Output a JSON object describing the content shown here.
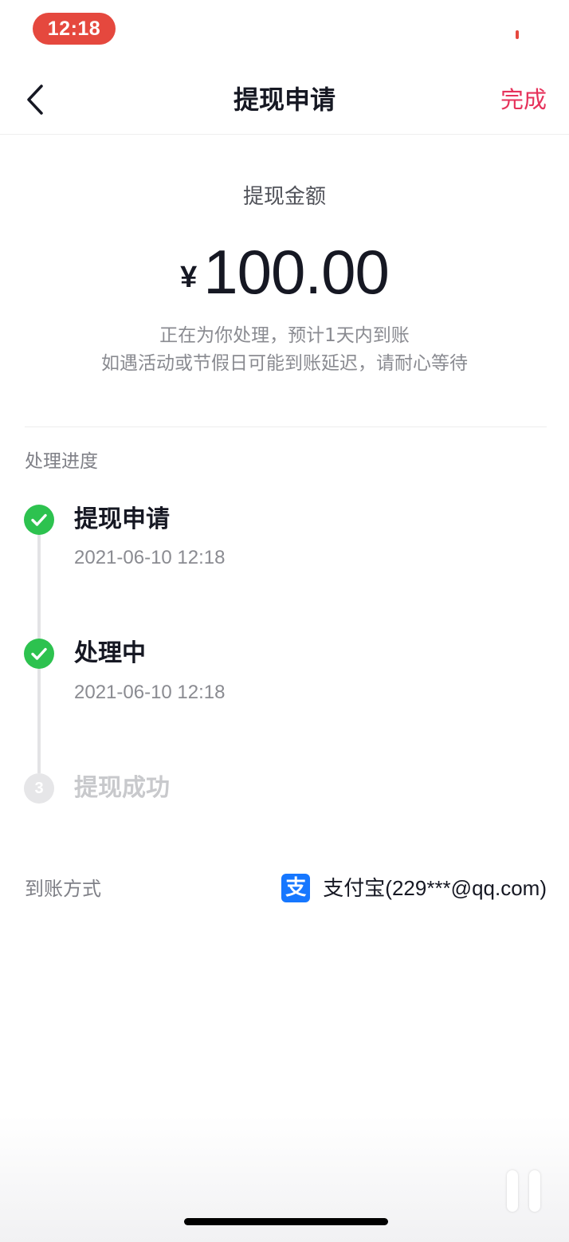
{
  "status_bar": {
    "time": "12:18"
  },
  "nav": {
    "back_icon": "chevron-left-icon",
    "title": "提现申请",
    "done_label": "完成",
    "done_color": "#e6325b"
  },
  "summary": {
    "amount_label": "提现金额",
    "currency_symbol": "¥",
    "amount": "100.00",
    "note_line1": "正在为你处理，预计1天内到账",
    "note_line2": "如遇活动或节假日可能到账延迟，请耐心等待"
  },
  "progress": {
    "heading": "处理进度",
    "steps": [
      {
        "title": "提现申请",
        "time": "2021-06-10 12:18",
        "status": "done",
        "icon": "check-icon"
      },
      {
        "title": "处理中",
        "time": "2021-06-10 12:18",
        "status": "done",
        "icon": "check-icon"
      },
      {
        "title": "提现成功",
        "number": "3",
        "status": "pending"
      }
    ],
    "done_color": "#2dc24f"
  },
  "payout": {
    "label": "到账方式",
    "icon": "alipay-icon",
    "icon_glyph": "支",
    "account": "支付宝(229***@qq.com)"
  }
}
